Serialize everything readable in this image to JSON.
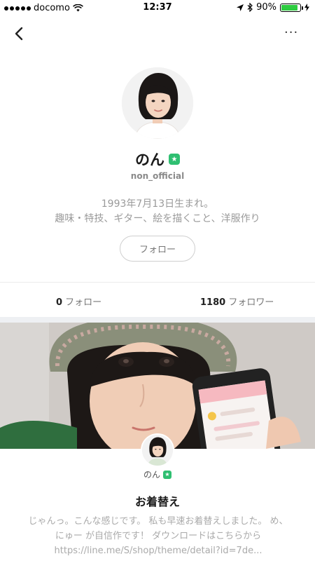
{
  "status_bar": {
    "carrier": "docomo",
    "time": "12:37",
    "battery": "90%",
    "battery_level": 0.9
  },
  "nav": {
    "back_icon": "chevron-left-icon",
    "more_icon": "more-horizontal-icon",
    "more_glyph": "···"
  },
  "profile": {
    "name": "のん",
    "handle": "non_official",
    "bio_line1": "1993年7月13日生まれ。",
    "bio_line2": "趣味・特技、ギター、絵を描くこと、洋服作り",
    "follow_button": "フォロー",
    "verified_color": "#2fbf71"
  },
  "stats": {
    "following_count": "0",
    "following_label": " フォロー",
    "followers_count": "1180",
    "followers_label": " フォロワー"
  },
  "post": {
    "author": "のん",
    "title": "お着替え",
    "body": "じゃんっ。こんな感じです。 私も早速お着替えしました。 め、にゅー が自信作です！ ダウンロードはこちらから https://line.me/S/shop/theme/detail?id=7de..."
  }
}
